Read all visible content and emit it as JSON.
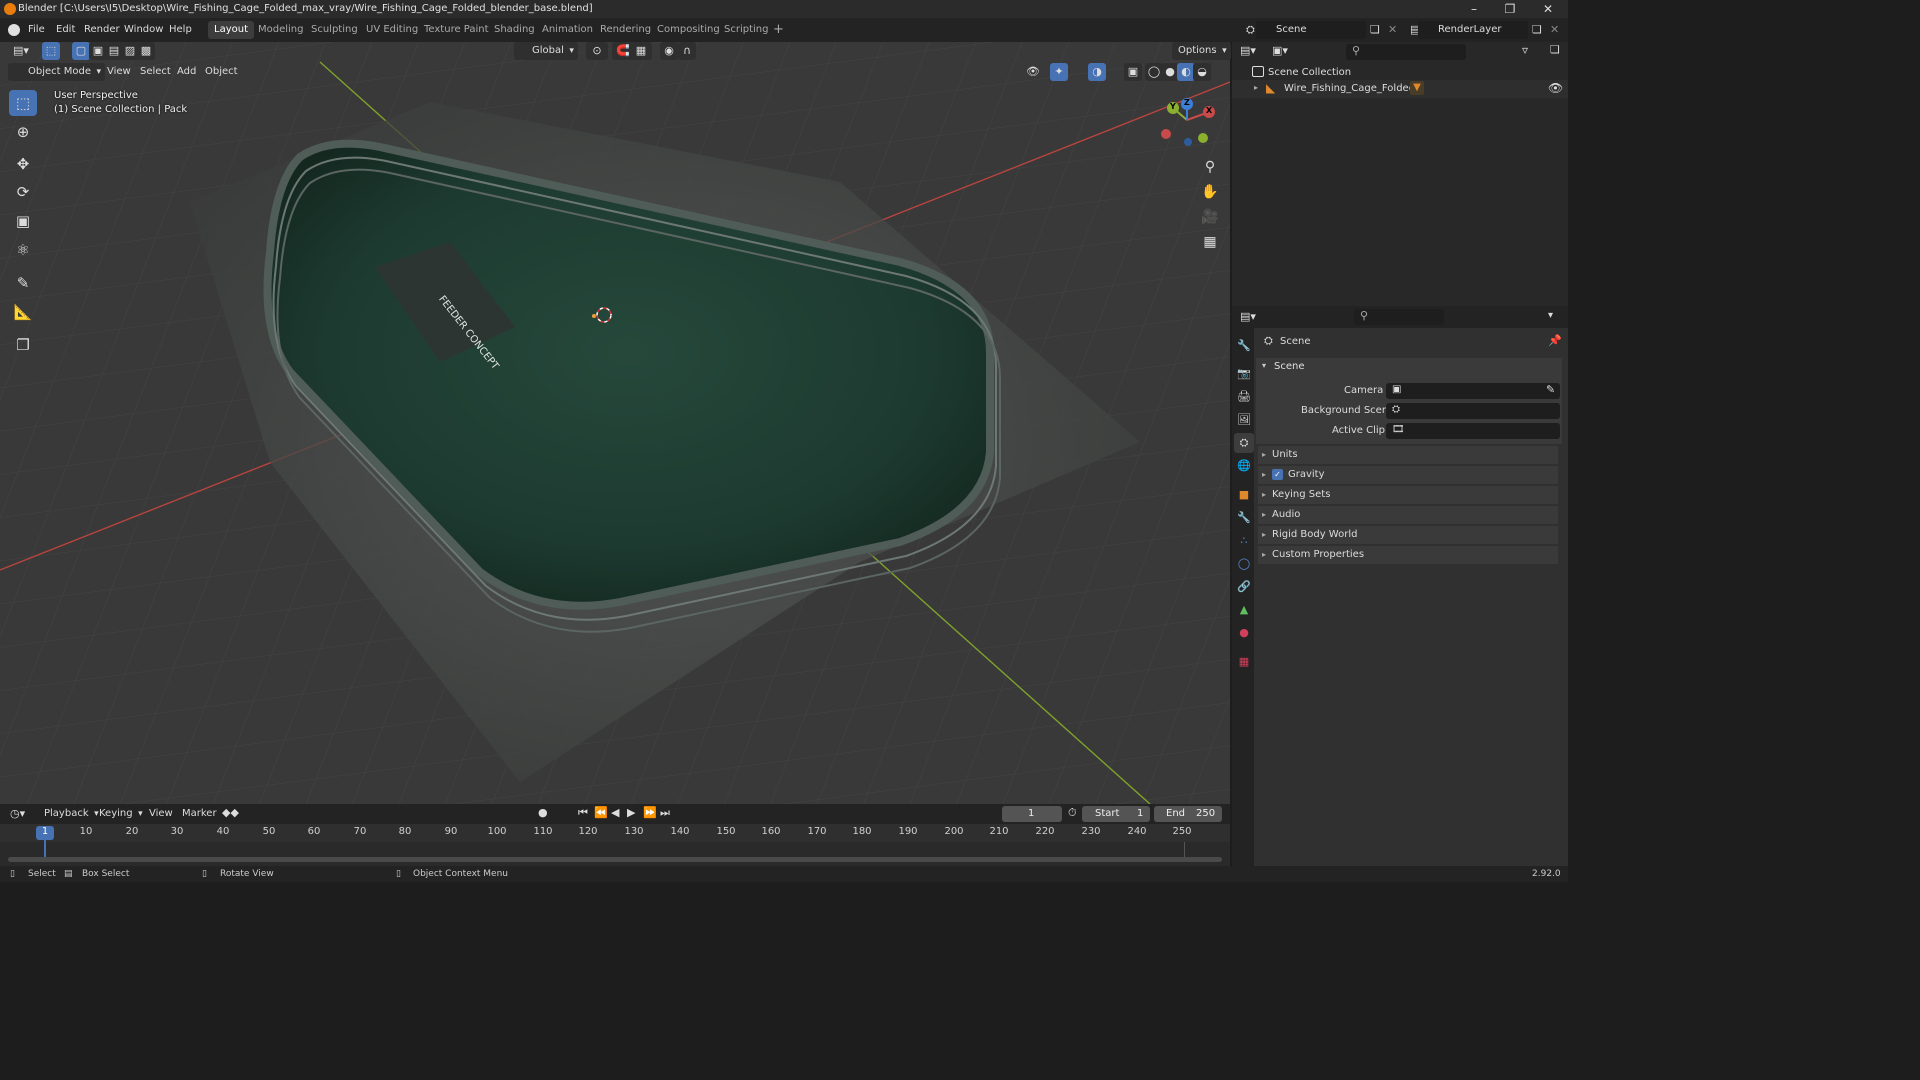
{
  "window": {
    "title": "Blender [C:\\Users\\I5\\Desktop\\Wire_Fishing_Cage_Folded_max_vray/Wire_Fishing_Cage_Folded_blender_base.blend]"
  },
  "menu": [
    "File",
    "Edit",
    "Render",
    "Window",
    "Help"
  ],
  "workspaces": [
    "Layout",
    "Modeling",
    "Sculpting",
    "UV Editing",
    "Texture Paint",
    "Shading",
    "Animation",
    "Rendering",
    "Compositing",
    "Scripting"
  ],
  "workspace_add": "+",
  "scene": {
    "name": "Scene",
    "render_layer": "RenderLayer"
  },
  "viewport_header": {
    "mode": "Object Mode",
    "menus": [
      "View",
      "Select",
      "Add",
      "Object"
    ],
    "orientation": "Global",
    "options": "Options"
  },
  "viewport_overlay": {
    "perspective": "User Perspective",
    "collection": "(1) Scene Collection | Pack"
  },
  "gizmo": {
    "x": "X",
    "y": "Y",
    "z": "Z"
  },
  "mesh_label": "FEEDER CONCEPT",
  "outliner": {
    "root": "Scene Collection",
    "items": [
      {
        "label": "Wire_Fishing_Cage_Folded"
      }
    ]
  },
  "properties": {
    "context": "Scene",
    "section": "Scene",
    "fields": [
      {
        "label": "Camera"
      },
      {
        "label": "Background Scene"
      },
      {
        "label": "Active Clip"
      }
    ],
    "panels": [
      "Units",
      "Gravity",
      "Keying Sets",
      "Audio",
      "Rigid Body World",
      "Custom Properties"
    ],
    "gravity_checked": true
  },
  "timeline": {
    "menus": [
      "Playback",
      "Keying",
      "View",
      "Marker"
    ],
    "current_frame": "1",
    "start_label": "Start",
    "start": "1",
    "end_label": "End",
    "end": "250",
    "ticks": [
      "1",
      "10",
      "20",
      "30",
      "40",
      "50",
      "60",
      "70",
      "80",
      "90",
      "100",
      "110",
      "120",
      "130",
      "140",
      "150",
      "160",
      "170",
      "180",
      "190",
      "200",
      "210",
      "220",
      "230",
      "240",
      "250"
    ]
  },
  "statusbar": {
    "select": "Select",
    "box_select": "Box Select",
    "rotate": "Rotate View",
    "context_menu": "Object Context Menu",
    "version": "2.92.0"
  },
  "colors": {
    "accent": "#4772b3",
    "x_axis": "#c84a4a",
    "y_axis": "#8ab02e",
    "z_axis": "#3d7fd6",
    "mesh_green": "#1f3f33"
  }
}
